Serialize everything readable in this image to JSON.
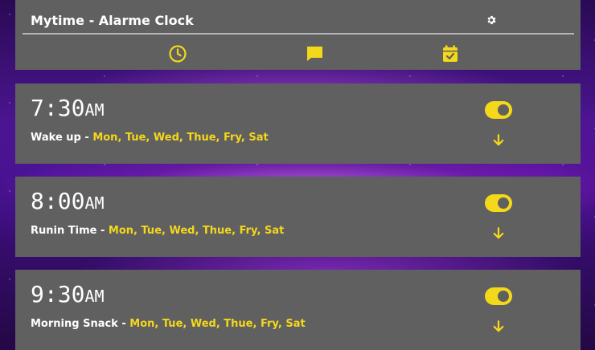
{
  "app": {
    "title": "Mytime - Alarme Clock"
  },
  "header": {
    "settings_icon": "gear-icon",
    "tabs": [
      {
        "icon": "clock-icon",
        "name": "alarms"
      },
      {
        "icon": "message-icon",
        "name": "messages"
      },
      {
        "icon": "calendar-check-icon",
        "name": "calendar"
      }
    ]
  },
  "alarms": [
    {
      "time": "7:30",
      "ampm": "AM",
      "name": "Wake up",
      "separator": " - ",
      "days": "Mon, Tue, Wed, Thue, Fry, Sat",
      "enabled": true
    },
    {
      "time": "8:00",
      "ampm": "AM",
      "name": "Runin Time",
      "separator": " - ",
      "days": "Mon, Tue, Wed, Thue, Fry, Sat",
      "enabled": true
    },
    {
      "time": "9:30",
      "ampm": "AM",
      "name": "Morning Snack",
      "separator": " - ",
      "days": "Mon, Tue, Wed, Thue, Fry, Sat",
      "enabled": true
    }
  ],
  "colors": {
    "accent": "#f4d81a",
    "panel": "#606060",
    "text": "#ffffff"
  }
}
